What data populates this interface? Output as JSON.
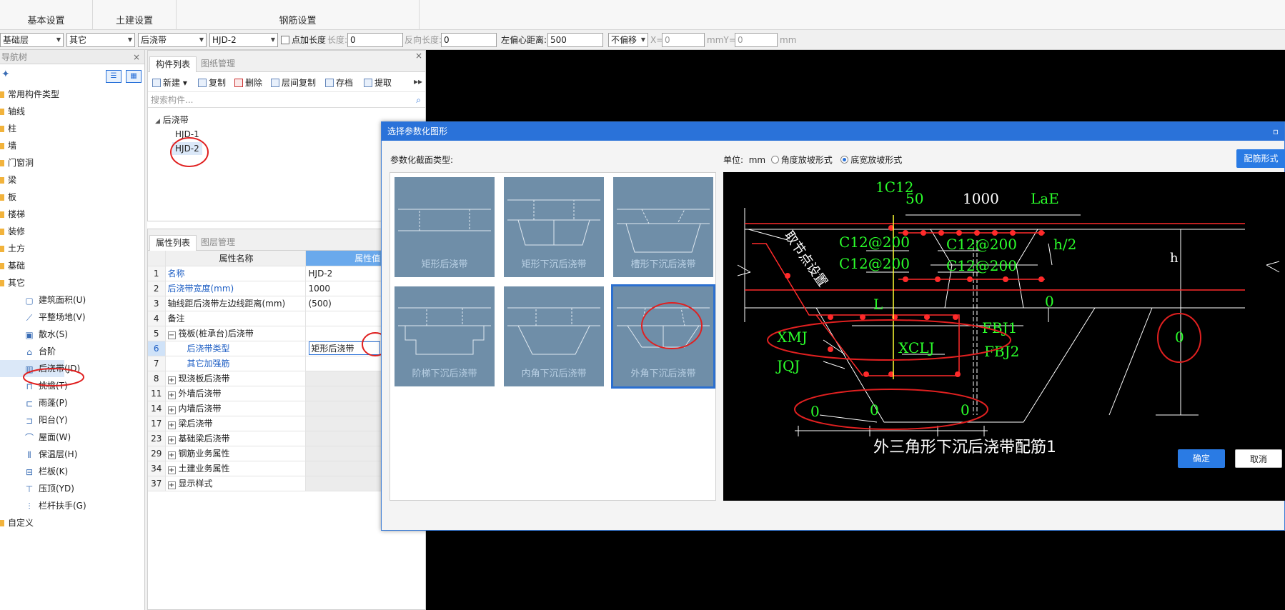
{
  "ribbon": {
    "tabs": [
      "基本设置",
      "土建设置",
      "钢筋设置"
    ]
  },
  "toolbar": {
    "floor": "基础层",
    "category": "其它",
    "type": "后浇带",
    "component": "HJD-2",
    "add_length_label": "点加长度",
    "length_label": "长度:",
    "length_value": "0",
    "reverse_length_label": "反向长度:",
    "reverse_length_value": "0",
    "offset_label": "左偏心距离:",
    "offset_value": "500",
    "shift_select": "不偏移",
    "x_label": "X=",
    "x_value": "0",
    "xunit_y_label": "mmY=",
    "y_value": "0",
    "y_unit": "mm"
  },
  "nav": {
    "title": "导航树",
    "items": [
      "常用构件类型",
      "轴线",
      "柱",
      "墙",
      "门窗洞",
      "梁",
      "板",
      "楼梯",
      "装修",
      "土方",
      "基础",
      "其它"
    ],
    "sub_items": [
      "建筑面积(U)",
      "平整场地(V)",
      "散水(S)",
      "台阶",
      "后浇带(JD)",
      "挑檐(T)",
      "雨蓬(P)",
      "阳台(Y)",
      "屋面(W)",
      "保温层(H)",
      "栏板(K)",
      "压顶(YD)",
      "栏杆扶手(G)"
    ],
    "last_item": "自定义"
  },
  "components": {
    "tabs": [
      "构件列表",
      "图纸管理"
    ],
    "tools": [
      "新建",
      "复制",
      "删除",
      "层间复制",
      "存档",
      "提取"
    ],
    "search_placeholder": "搜索构件...",
    "tree_root": "后浇带",
    "items": [
      "HJD-1",
      "HJD-2"
    ]
  },
  "props": {
    "tabs": [
      "属性列表",
      "图层管理"
    ],
    "header_name": "属性名称",
    "header_value": "属性值",
    "rows": [
      {
        "num": "1",
        "name": "名称",
        "value": "HJD-2"
      },
      {
        "num": "2",
        "name": "后浇带宽度(mm)",
        "value": "1000"
      },
      {
        "num": "3",
        "name": "轴线距后浇带左边线距离(mm)",
        "value": "(500)"
      },
      {
        "num": "4",
        "name": "备注",
        "value": ""
      },
      {
        "num": "5",
        "name": "筏板(桩承台)后浇带",
        "value": ""
      },
      {
        "num": "6",
        "name": "后浇带类型",
        "value": "矩形后浇带"
      },
      {
        "num": "7",
        "name": "其它加强筋",
        "value": ""
      },
      {
        "num": "8",
        "name": "现浇板后浇带",
        "value": ""
      },
      {
        "num": "11",
        "name": "外墙后浇带",
        "value": ""
      },
      {
        "num": "14",
        "name": "内墙后浇带",
        "value": ""
      },
      {
        "num": "17",
        "name": "梁后浇带",
        "value": ""
      },
      {
        "num": "23",
        "name": "基础梁后浇带",
        "value": ""
      },
      {
        "num": "29",
        "name": "钢筋业务属性",
        "value": ""
      },
      {
        "num": "34",
        "name": "土建业务属性",
        "value": ""
      },
      {
        "num": "37",
        "name": "显示样式",
        "value": ""
      }
    ]
  },
  "dialog": {
    "title": "选择参数化图形",
    "section_label": "参数化截面类型:",
    "unit_label": "单位:",
    "unit_value": "mm",
    "radio1": "角度放坡形式",
    "radio2": "底宽放坡形式",
    "rebar_button": "配筋形式",
    "shapes": [
      "矩形后浇带",
      "矩形下沉后浇带",
      "槽形下沉后浇带",
      "阶梯下沉后浇带",
      "内角下沉后浇带",
      "外角下沉后浇带"
    ],
    "ok": "确定",
    "cancel": "取消"
  },
  "cad": {
    "title": "外三角形下沉后浇带配筋1",
    "labels": {
      "c1": "1C12",
      "d50": "50",
      "d1000": "1000",
      "lae": "LaE",
      "r1": "C12@200",
      "r2": "C12@200",
      "r3": "C12@200",
      "r4": "C12@200",
      "h2": "h/2",
      "h": "h",
      "l": "L",
      "zero_r": "0",
      "zero_big": "0",
      "xmj": "XMJ",
      "jqj": "JQJ",
      "fbj1": "FBJ1",
      "fbj2": "FBJ2",
      "xclj": "XCLJ",
      "b1": "0",
      "b2": "0",
      "b3": "0",
      "rotated": "取节点设置"
    }
  }
}
